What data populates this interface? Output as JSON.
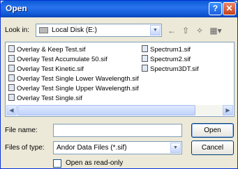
{
  "window": {
    "title": "Open"
  },
  "lookin": {
    "label": "Look in:",
    "value": "Local Disk (E:)"
  },
  "toolbar": {
    "icons": [
      "back-icon",
      "up-folder-icon",
      "new-folder-icon",
      "view-menu-icon"
    ]
  },
  "files": [
    {
      "name": "Overlay & Keep Test.sif"
    },
    {
      "name": "Overlay Test Accumulate 50.sif"
    },
    {
      "name": "Overlay Test Kinetic.sif"
    },
    {
      "name": "Overlay Test Single Lower Wavelength.sif"
    },
    {
      "name": "Overlay Test Single Upper Wavelength.sif"
    },
    {
      "name": "Overlay Test Single.sif"
    },
    {
      "name": "Spectrum1.sif"
    },
    {
      "name": "Spectrum2.sif"
    },
    {
      "name": "Spectrum3DT.sif"
    }
  ],
  "filename": {
    "label": "File name:",
    "value": ""
  },
  "filetype": {
    "label": "Files of type:",
    "value": "Andor Data Files  (*.sif)"
  },
  "buttons": {
    "open": "Open",
    "cancel": "Cancel"
  },
  "readonly": {
    "label": "Open as read-only",
    "checked": false
  }
}
